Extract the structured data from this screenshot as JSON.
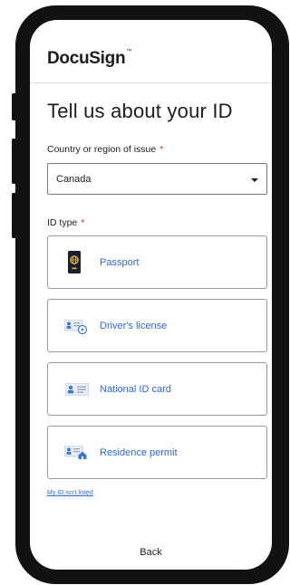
{
  "header": {
    "logo": "DocuSign"
  },
  "page": {
    "title": "Tell us about your ID"
  },
  "country": {
    "label": "Country or region of issue",
    "required_mark": "*",
    "selected": "Canada"
  },
  "id_type": {
    "label": "ID type",
    "required_mark": "*",
    "options": [
      {
        "label": "Passport",
        "icon": "passport-icon"
      },
      {
        "label": "Driver's license",
        "icon": "drivers-license-icon"
      },
      {
        "label": "National ID card",
        "icon": "national-id-card-icon"
      },
      {
        "label": "Residence permit",
        "icon": "residence-permit-icon"
      }
    ]
  },
  "links": {
    "not_listed": "My ID isn't listed"
  },
  "footer": {
    "back_label": "Back"
  },
  "colors": {
    "link_blue": "#2a6ad9",
    "required_red": "#d0342c",
    "frame": "#121212"
  }
}
